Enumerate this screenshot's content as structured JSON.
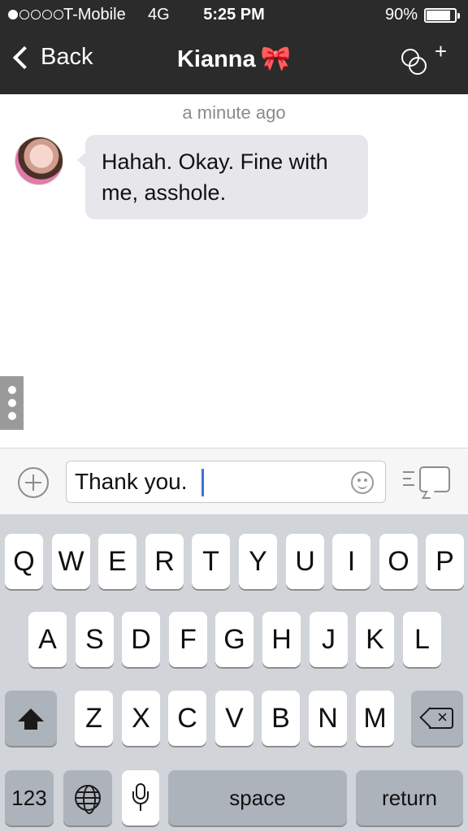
{
  "status_bar": {
    "carrier": "T-Mobile",
    "network": "4G",
    "time": "5:25 PM",
    "battery_percent": "90%",
    "battery_level": 0.9,
    "signal_bars_filled": 1,
    "signal_bars_total": 5
  },
  "nav": {
    "back_label": "Back",
    "title": "Kianna",
    "title_emoji": "🎀",
    "right_icon": "add-to-group-icon"
  },
  "chat": {
    "timestamp": "a minute ago",
    "messages": [
      {
        "sender": "Kianna",
        "text": "Hahah. Okay. Fine with me, asshole."
      }
    ]
  },
  "input": {
    "value": "Thank you.",
    "left_icon": "plus-icon",
    "emoji_icon": "smiley-icon",
    "send_icon": "quick-reply-icon"
  },
  "keyboard": {
    "row1": [
      "Q",
      "W",
      "E",
      "R",
      "T",
      "Y",
      "U",
      "I",
      "O",
      "P"
    ],
    "row2": [
      "A",
      "S",
      "D",
      "F",
      "G",
      "H",
      "J",
      "K",
      "L"
    ],
    "row3": [
      "Z",
      "X",
      "C",
      "V",
      "B",
      "N",
      "M"
    ],
    "numbers_label": "123",
    "space_label": "space",
    "return_label": "return"
  },
  "colors": {
    "nav_bg": "#2b2b2b",
    "bubble_bg": "#e6e6eb",
    "keyboard_bg": "#d1d4d9",
    "caret": "#3b73d9"
  }
}
